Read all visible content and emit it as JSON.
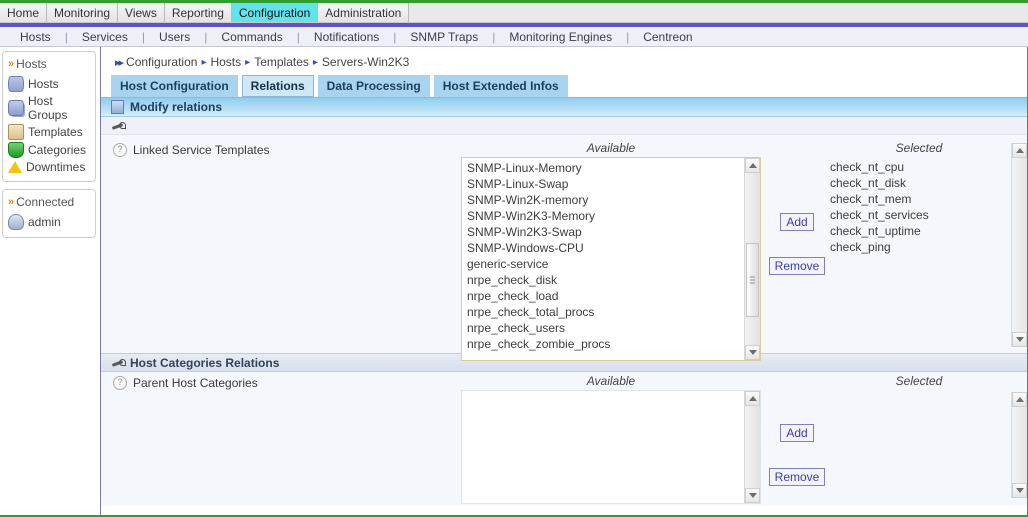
{
  "mainmenu": {
    "items": [
      {
        "label": "Home",
        "active": false
      },
      {
        "label": "Monitoring",
        "active": false
      },
      {
        "label": "Views",
        "active": false
      },
      {
        "label": "Reporting",
        "active": false
      },
      {
        "label": "Configuration",
        "active": true
      },
      {
        "label": "Administration",
        "active": false
      }
    ]
  },
  "submenu": {
    "items": [
      {
        "label": "Hosts"
      },
      {
        "label": "Services"
      },
      {
        "label": "Users"
      },
      {
        "label": "Commands"
      },
      {
        "label": "Notifications"
      },
      {
        "label": "SNMP Traps"
      },
      {
        "label": "Monitoring Engines"
      },
      {
        "label": "Centreon"
      }
    ],
    "separator": "|"
  },
  "sidebar": {
    "hosts_box": {
      "title": "Hosts",
      "marker": "»",
      "items": [
        {
          "label": "Hosts",
          "icon": "database-icon"
        },
        {
          "label": "Host Groups",
          "icon": "database-stack-icon"
        },
        {
          "label": "Templates",
          "icon": "template-icon"
        },
        {
          "label": "Categories",
          "icon": "shield-icon"
        },
        {
          "label": "Downtimes",
          "icon": "warning-icon"
        }
      ]
    },
    "connected_box": {
      "title": "Connected",
      "marker": "»",
      "user": "admin",
      "user_icon": "user-icon"
    }
  },
  "breadcrumb": {
    "marker": "▸▸",
    "separator": "▸",
    "items": [
      "Configuration",
      "Hosts",
      "Templates",
      "Servers-Win2K3"
    ]
  },
  "tabs": [
    {
      "label": "Host Configuration",
      "active": false
    },
    {
      "label": "Relations",
      "active": true
    },
    {
      "label": "Data Processing",
      "active": false
    },
    {
      "label": "Host Extended Infos",
      "active": false
    }
  ],
  "modify_bar": {
    "title": "Modify relations",
    "icon": "list-icon"
  },
  "tool_row": {
    "icon": "pen-icon"
  },
  "sections": [
    {
      "field_label": "Linked Service Templates",
      "help_icon": "help-icon",
      "available_header": "Available",
      "selected_header": "Selected",
      "available": [
        "SNMP-Linux-Memory",
        "SNMP-Linux-Swap",
        "SNMP-Win2K-memory",
        "SNMP-Win2K3-Memory",
        "SNMP-Win2K3-Swap",
        "SNMP-Windows-CPU",
        "generic-service",
        "nrpe_check_disk",
        "nrpe_check_load",
        "nrpe_check_total_procs",
        "nrpe_check_users",
        "nrpe_check_zombie_procs"
      ],
      "selected": [
        "check_nt_cpu",
        "check_nt_disk",
        "check_nt_mem",
        "check_nt_services",
        "check_nt_uptime",
        "check_ping"
      ],
      "add_label": "Add",
      "remove_label": "Remove"
    }
  ],
  "categories_section": {
    "title": "Host Categories Relations",
    "icon": "pen-icon",
    "field_label": "Parent Host Categories",
    "help_icon": "help-icon",
    "available_header": "Available",
    "selected_header": "Selected",
    "available": [],
    "selected": [],
    "add_label": "Add",
    "remove_label": "Remove"
  },
  "colors": {
    "accent_green": "#2fa02f",
    "menu_active": "#62e2ea",
    "purple_bar": "#5b55c4",
    "section_blue": "#8fcdf0",
    "tab_blue": "#a9d4ef",
    "tab_active": "#cfe7f7",
    "list_border": "#e0cb9a"
  }
}
